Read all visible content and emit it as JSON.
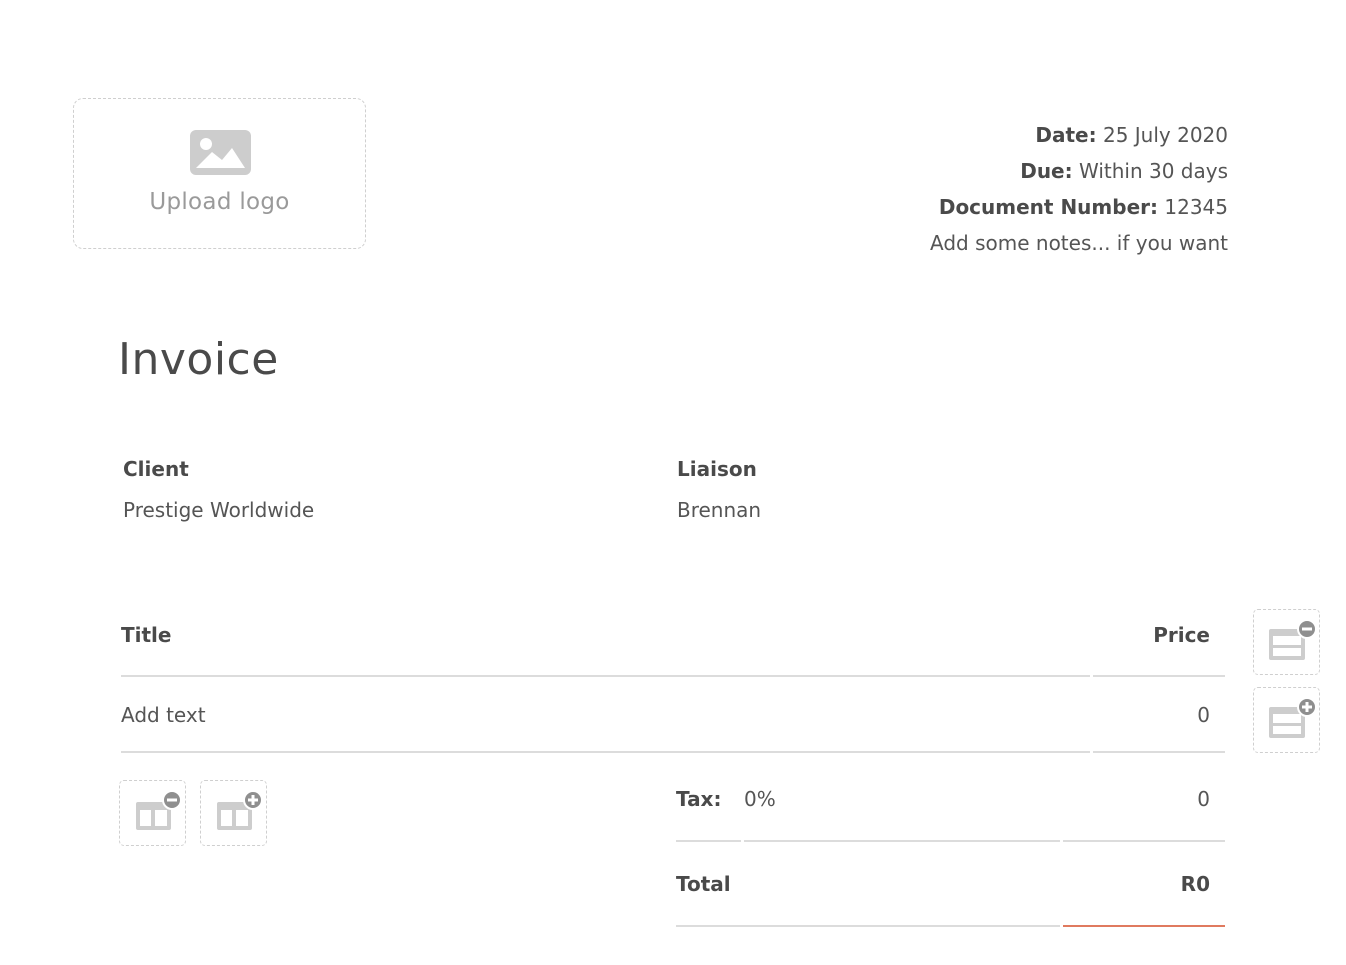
{
  "logo": {
    "label": "Upload logo",
    "icon": "image-icon"
  },
  "meta": {
    "date_label": "Date:",
    "date_value": "25 July 2020",
    "due_label": "Due:",
    "due_value": "Within 30 days",
    "doc_number_label": "Document Number:",
    "doc_number_value": "12345",
    "notes": "Add some notes... if you want"
  },
  "document": {
    "title": "Invoice"
  },
  "client": {
    "label": "Client",
    "value": "Prestige Worldwide"
  },
  "liaison": {
    "label": "Liaison",
    "value": "Brennan"
  },
  "table": {
    "headers": {
      "title": "Title",
      "price": "Price"
    },
    "rows": [
      {
        "title": "Add text",
        "price": "0"
      }
    ]
  },
  "summary": {
    "tax_label": "Tax:",
    "tax_rate": "0%",
    "tax_amount": "0",
    "total_label": "Total",
    "total_value": "R0"
  },
  "controls": {
    "remove_column": "remove-column-icon",
    "add_column": "add-column-icon",
    "remove_row": "remove-row-icon",
    "add_row": "add-row-icon"
  },
  "colors": {
    "accent": "#e07a5f",
    "text": "#4a4a4a",
    "muted": "#9a9a9a",
    "rule": "#dcdcdc"
  }
}
